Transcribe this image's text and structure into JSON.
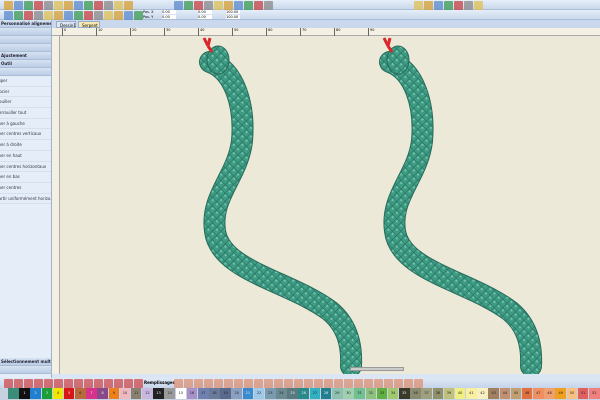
{
  "tabs": [
    {
      "label": "Dessin1"
    },
    {
      "label": "Serpent"
    }
  ],
  "sidebar": {
    "headers": [
      "Personnalisé alignement",
      "",
      "",
      "",
      "Ajustement",
      "Outil",
      ""
    ],
    "items": [
      "Grouper",
      "Dissocier",
      "Verrouiller",
      "Déverrouiller tout",
      "Aligner à gauche",
      "Aligner centres verticaux",
      "Aligner à droite",
      "Aligner en haut",
      "Aligner centres horizontaux",
      "Aligner en bas",
      "Aligner centres",
      "Répartir uniformément horizo..."
    ],
    "footer": [
      "Sélectionnement multiple",
      ""
    ]
  },
  "toolbar": {
    "pos_x_label": "Pos. X",
    "pos_y_label": "Pos. Y",
    "pos_x": "0.00",
    "pos_y": "0.00",
    "width": "0.00",
    "height": "0.00",
    "scale_w": "100.00",
    "scale_h": "100.00"
  },
  "stitchbar": {
    "fill_label": "Remplissages"
  },
  "ruler": {
    "ticks": [
      "0",
      "10",
      "20",
      "30",
      "40",
      "50",
      "60",
      "70",
      "80",
      "90"
    ]
  },
  "colors": {
    "snake": "#3e9b84",
    "snake_dark": "#256b5a",
    "tongue": "#d8282a",
    "canvas": "#ede9d8"
  },
  "palette": [
    {
      "n": "",
      "c": "#3a8d78"
    },
    {
      "n": "1",
      "c": "#111111"
    },
    {
      "n": "2",
      "c": "#1f7fd0"
    },
    {
      "n": "3",
      "c": "#1a9e3a"
    },
    {
      "n": "4",
      "c": "#f2e600"
    },
    {
      "n": "5",
      "c": "#d81818"
    },
    {
      "n": "6",
      "c": "#b86a3a"
    },
    {
      "n": "7",
      "c": "#d8338a"
    },
    {
      "n": "8",
      "c": "#8a4a8a"
    },
    {
      "n": "9",
      "c": "#ee7f1a"
    },
    {
      "n": "10",
      "c": "#f0b8c0"
    },
    {
      "n": "11",
      "c": "#8a8070"
    },
    {
      "n": "12",
      "c": "#c8b8e0"
    },
    {
      "n": "13",
      "c": "#222222"
    },
    {
      "n": "14",
      "c": "#9a9a9a"
    },
    {
      "n": "15",
      "c": "#ffffff"
    },
    {
      "n": "16",
      "c": "#a890c8"
    },
    {
      "n": "17",
      "c": "#7080b0"
    },
    {
      "n": "18",
      "c": "#6a7a9a"
    },
    {
      "n": "19",
      "c": "#5a6a8a"
    },
    {
      "n": "20",
      "c": "#8aa0c0"
    },
    {
      "n": "21",
      "c": "#3a8ad0"
    },
    {
      "n": "22",
      "c": "#a0c8e8"
    },
    {
      "n": "23",
      "c": "#7a9ab0"
    },
    {
      "n": "24",
      "c": "#6a8a90"
    },
    {
      "n": "25",
      "c": "#5a7a80"
    },
    {
      "n": "26",
      "c": "#2a8a8a"
    },
    {
      "n": "27",
      "c": "#30b0c0"
    },
    {
      "n": "28",
      "c": "#208090"
    },
    {
      "n": "29",
      "c": "#90c0b0"
    },
    {
      "n": "30",
      "c": "#a0d0b0"
    },
    {
      "n": "31",
      "c": "#70c090"
    },
    {
      "n": "32",
      "c": "#90c080"
    },
    {
      "n": "33",
      "c": "#60b040"
    },
    {
      "n": "34",
      "c": "#a0c870"
    },
    {
      "n": "35",
      "c": "#3a3a2a"
    },
    {
      "n": "36",
      "c": "#8a8a70"
    },
    {
      "n": "37",
      "c": "#a0a080"
    },
    {
      "n": "38",
      "c": "#90906a"
    },
    {
      "n": "39",
      "c": "#c0c080"
    },
    {
      "n": "40",
      "c": "#f0f080"
    },
    {
      "n": "41",
      "c": "#f8f0a0"
    },
    {
      "n": "42",
      "c": "#f8f0c0"
    },
    {
      "n": "43",
      "c": "#a08060"
    },
    {
      "n": "44",
      "c": "#c09070"
    },
    {
      "n": "45",
      "c": "#c0a070"
    },
    {
      "n": "46",
      "c": "#e07040"
    },
    {
      "n": "47",
      "c": "#f09060"
    },
    {
      "n": "48",
      "c": "#f0a070"
    },
    {
      "n": "49",
      "c": "#f0a020"
    },
    {
      "n": "50",
      "c": "#f8c080"
    },
    {
      "n": "51",
      "c": "#e06060"
    },
    {
      "n": "52",
      "c": "#f08080"
    }
  ]
}
